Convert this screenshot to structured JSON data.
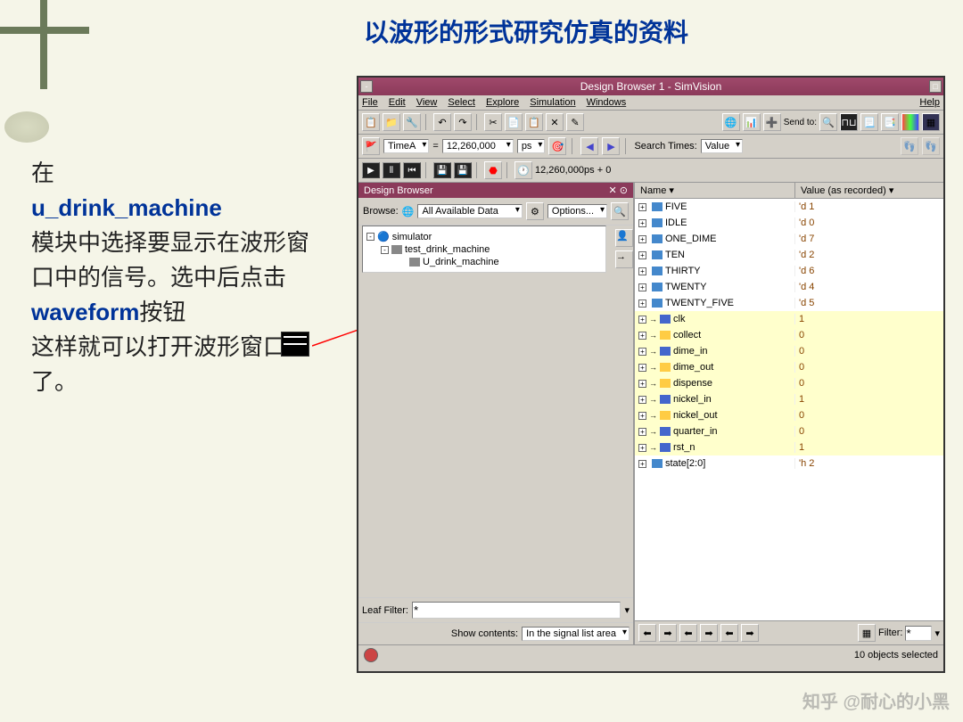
{
  "slide": {
    "title": "以波形的形式研究仿真的资料",
    "text1": "在",
    "module": "u_drink_machine",
    "text2": "模块中选择要显示在波形窗口中的信号。选中后点击",
    "waveform": "waveform",
    "text3": "按钮",
    "text4": "这样就可以打开波形窗口了。"
  },
  "window": {
    "title": "Design Browser 1 - SimVision",
    "menu": {
      "file": "File",
      "edit": "Edit",
      "view": "View",
      "select": "Select",
      "explore": "Explore",
      "simulation": "Simulation",
      "windows": "Windows",
      "help": "Help"
    },
    "time": {
      "label": "TimeA",
      "value": "12,260,000",
      "unit": "ps",
      "search": "Search Times:",
      "search_val": "Value"
    },
    "play_time": "12,260,000ps + 0",
    "send_to": "Send to:",
    "browser": {
      "title": "Design Browser",
      "browse_label": "Browse:",
      "browse_value": "All Available Data",
      "options": "Options...",
      "tree": {
        "root": "simulator",
        "child1": "test_drink_machine",
        "child2": "U_drink_machine"
      },
      "leaf_filter": "Leaf Filter:",
      "leaf_value": "*",
      "show_contents": "Show contents:",
      "show_value": "In the signal list area"
    },
    "columns": {
      "name": "Name",
      "value": "Value (as recorded)"
    },
    "signals": [
      {
        "name": "FIVE",
        "value": "'d 1",
        "type": "module",
        "yellow": false
      },
      {
        "name": "IDLE",
        "value": "'d 0",
        "type": "module",
        "yellow": false
      },
      {
        "name": "ONE_DIME",
        "value": "'d 7",
        "type": "module",
        "yellow": false
      },
      {
        "name": "TEN",
        "value": "'d 2",
        "type": "module",
        "yellow": false
      },
      {
        "name": "THIRTY",
        "value": "'d 6",
        "type": "module",
        "yellow": false
      },
      {
        "name": "TWENTY",
        "value": "'d 4",
        "type": "module",
        "yellow": false
      },
      {
        "name": "TWENTY_FIVE",
        "value": "'d 5",
        "type": "module",
        "yellow": false
      },
      {
        "name": "clk",
        "value": "1",
        "type": "in",
        "yellow": true
      },
      {
        "name": "collect",
        "value": "0",
        "type": "out",
        "yellow": true
      },
      {
        "name": "dime_in",
        "value": "0",
        "type": "in",
        "yellow": true
      },
      {
        "name": "dime_out",
        "value": "0",
        "type": "out",
        "yellow": true
      },
      {
        "name": "dispense",
        "value": "0",
        "type": "out",
        "yellow": true
      },
      {
        "name": "nickel_in",
        "value": "1",
        "type": "in",
        "yellow": true
      },
      {
        "name": "nickel_out",
        "value": "0",
        "type": "out",
        "yellow": true
      },
      {
        "name": "quarter_in",
        "value": "0",
        "type": "in",
        "yellow": true
      },
      {
        "name": "rst_n",
        "value": "1",
        "type": "in",
        "yellow": true
      },
      {
        "name": "state[2:0]",
        "value": "'h 2",
        "type": "module",
        "yellow": false
      }
    ],
    "filter": "Filter:",
    "filter_val": "*",
    "status": "10 objects selected"
  },
  "watermark": "知乎 @耐心的小黑"
}
